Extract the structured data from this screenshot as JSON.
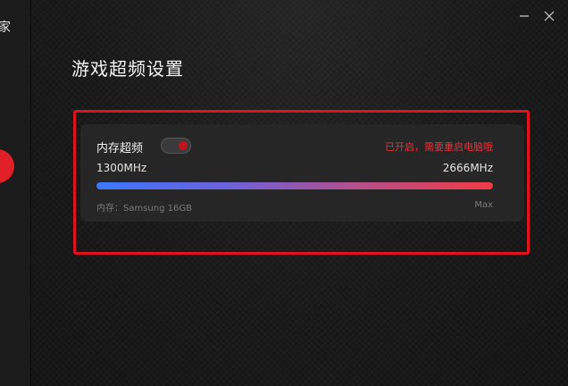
{
  "sidebar": {
    "app_title_fragment": "家",
    "active_color": "#e01f26"
  },
  "window_controls": {
    "minimize_icon": "minimize-icon",
    "close_icon": "close-icon"
  },
  "page": {
    "title": "游戏超频设置"
  },
  "memory_oc": {
    "label": "内存超频",
    "enabled": true,
    "status_text": "已开启，需要重启电脑哦",
    "min_freq": "1300MHz",
    "max_freq": "2666MHz",
    "current_fraction": 1.0,
    "memory_info": "内存：Samsung 16GB",
    "level_label": "Max"
  },
  "colors": {
    "accent": "#e01f26",
    "status": "#e8323a",
    "highlight_frame": "#e0121d",
    "bar_start": "#3a78ff",
    "bar_end": "#f23a43"
  }
}
